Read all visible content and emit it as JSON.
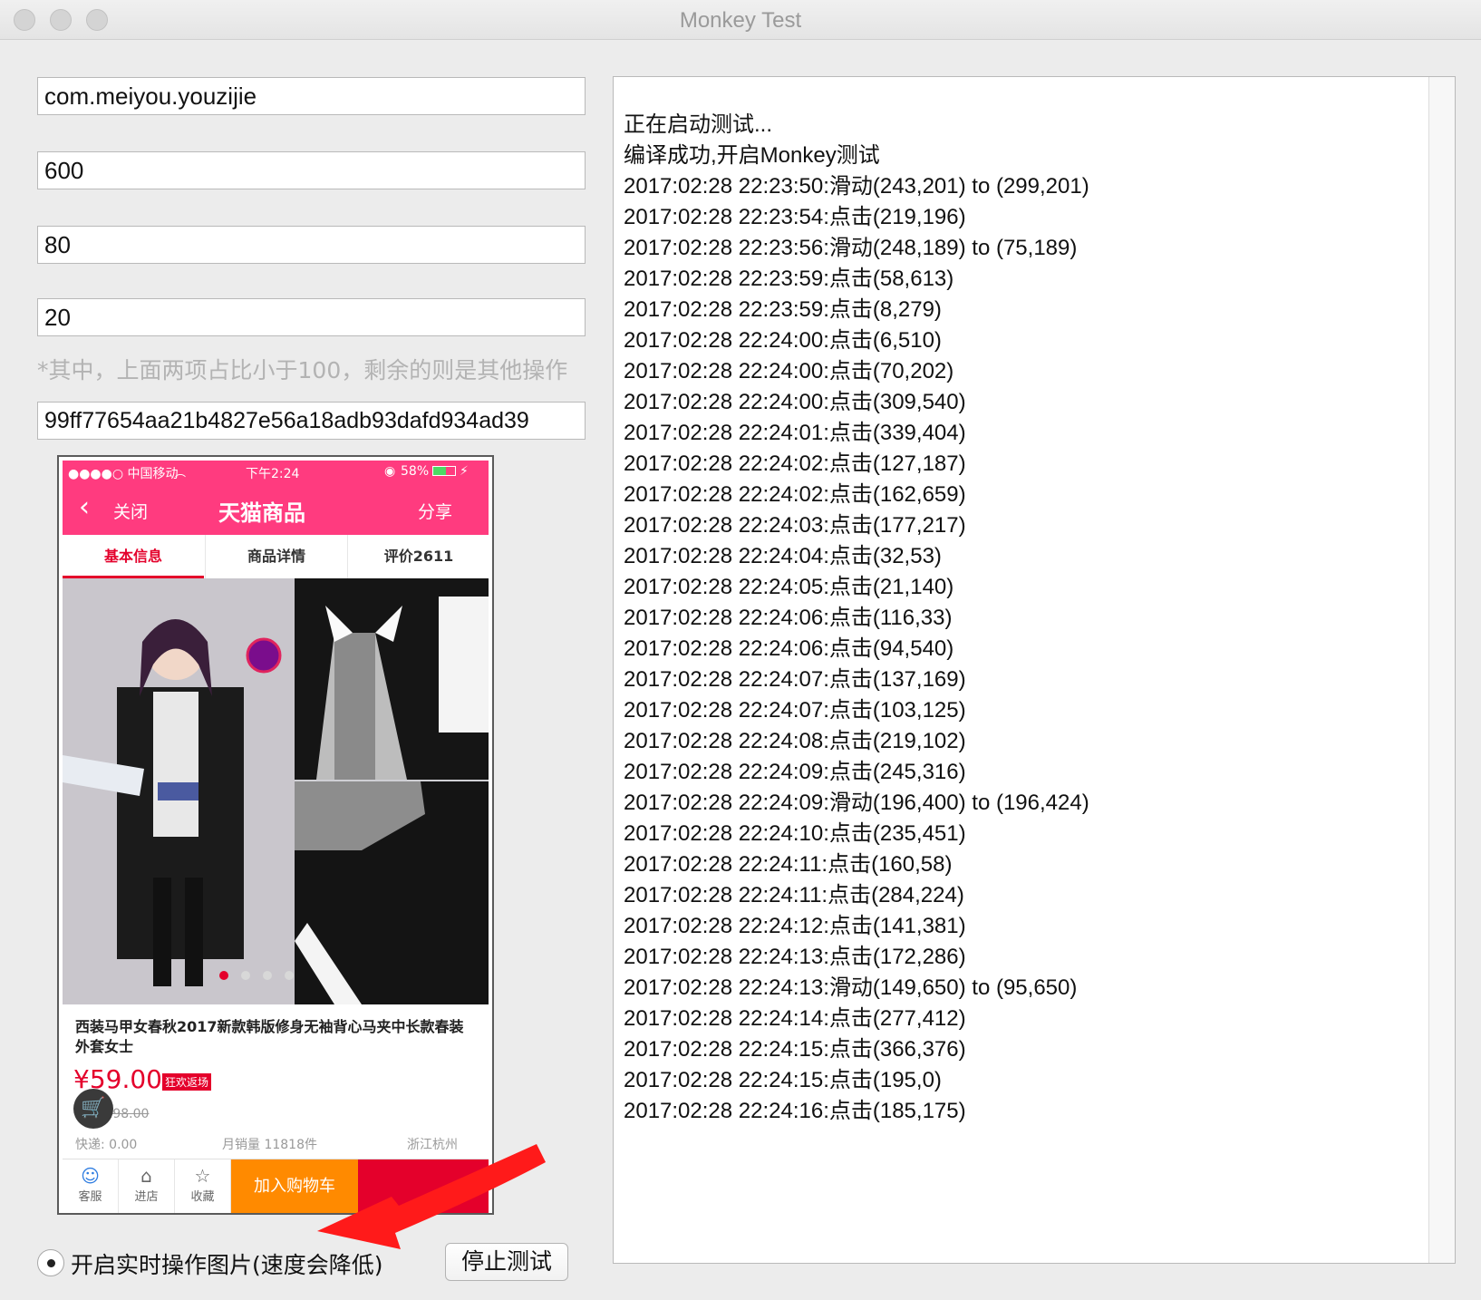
{
  "window": {
    "title": "Monkey Test"
  },
  "form": {
    "package_name": "com.meiyou.youzijie",
    "field_2": "600",
    "field_3": "80",
    "field_4": "20",
    "hint": "*其中，上面两项占比小于100，剩余的则是其他操作",
    "device_id": "99ff77654aa21b4827e56a18adb93dafd934ad39"
  },
  "phone": {
    "status": {
      "carrier": "●●●●○ 中国移动",
      "time": "下午2:24",
      "battery": "58%"
    },
    "nav": {
      "back": "关闭",
      "title": "天猫商品",
      "share": "分享"
    },
    "tabs": [
      "基本信息",
      "商品详情",
      "评价2611"
    ],
    "product": {
      "title": "西装马甲女春秋2017新款韩版修身无袖背心马夹中长款春装外套女士",
      "price": "¥59.00",
      "badge": "狂欢返场",
      "old_price": "价格 298.00",
      "shipping": "快递: 0.00",
      "sales": "月销量 11818件",
      "location": "浙江杭州"
    },
    "bottom": {
      "service": "客服",
      "shop": "进店",
      "favorite": "收藏",
      "add_cart": "加入购物车"
    },
    "colors": {
      "brand": "#ff3b7f",
      "price": "#e4002b",
      "cart": "#ff8a00",
      "buy": "#e4002b"
    }
  },
  "log": [
    "正在启动测试...",
    "编译成功,开启Monkey测试",
    "2017:02:28 22:23:50:滑动(243,201) to (299,201)",
    "2017:02:28 22:23:54:点击(219,196)",
    "2017:02:28 22:23:56:滑动(248,189) to (75,189)",
    "2017:02:28 22:23:59:点击(58,613)",
    "2017:02:28 22:23:59:点击(8,279)",
    "2017:02:28 22:24:00:点击(6,510)",
    "2017:02:28 22:24:00:点击(70,202)",
    "2017:02:28 22:24:00:点击(309,540)",
    "2017:02:28 22:24:01:点击(339,404)",
    "2017:02:28 22:24:02:点击(127,187)",
    "2017:02:28 22:24:02:点击(162,659)",
    "2017:02:28 22:24:03:点击(177,217)",
    "2017:02:28 22:24:04:点击(32,53)",
    "2017:02:28 22:24:05:点击(21,140)",
    "2017:02:28 22:24:06:点击(116,33)",
    "2017:02:28 22:24:06:点击(94,540)",
    "2017:02:28 22:24:07:点击(137,169)",
    "2017:02:28 22:24:07:点击(103,125)",
    "2017:02:28 22:24:08:点击(219,102)",
    "2017:02:28 22:24:09:点击(245,316)",
    "2017:02:28 22:24:09:滑动(196,400) to (196,424)",
    "2017:02:28 22:24:10:点击(235,451)",
    "2017:02:28 22:24:11:点击(160,58)",
    "2017:02:28 22:24:11:点击(284,224)",
    "2017:02:28 22:24:12:点击(141,381)",
    "2017:02:28 22:24:13:点击(172,286)",
    "2017:02:28 22:24:13:滑动(149,650) to (95,650)",
    "2017:02:28 22:24:14:点击(277,412)",
    "2017:02:28 22:24:15:点击(366,376)",
    "2017:02:28 22:24:15:点击(195,0)",
    "2017:02:28 22:24:16:点击(185,175)"
  ],
  "controls": {
    "realtime_label": "开启实时操作图片(速度会降低)",
    "realtime_checked": true,
    "stop_button": "停止测试"
  }
}
